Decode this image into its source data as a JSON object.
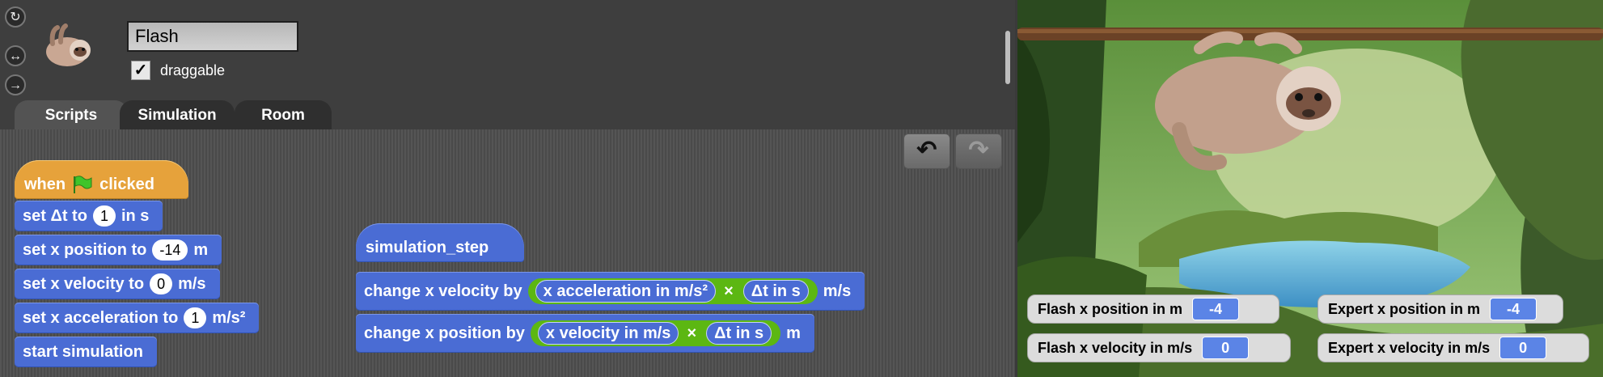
{
  "sprite": {
    "name": "Flash",
    "draggable_label": "draggable",
    "draggable_checked": "✓"
  },
  "rotation_buttons": [
    "↻",
    "↔",
    "→"
  ],
  "tabs": [
    {
      "label": "Scripts",
      "active": true
    },
    {
      "label": "Simulation",
      "active": false
    },
    {
      "label": "Room",
      "active": false
    }
  ],
  "toolbar": {
    "undo_icon": "undo-icon",
    "redo_icon": "redo-icon"
  },
  "script1": {
    "hat_when": "when",
    "hat_clicked": "clicked",
    "set_dt": {
      "label": "set Δt to",
      "value": "1",
      "unit": "in s"
    },
    "set_xpos": {
      "label": "set x position to",
      "value": "-14",
      "unit": "m"
    },
    "set_xvel": {
      "label": "set x velocity to",
      "value": "0",
      "unit": "m/s"
    },
    "set_xacc": {
      "label": "set x acceleration to",
      "value": "1",
      "unit": "m/s²"
    },
    "start": "start simulation"
  },
  "script2": {
    "hat": "simulation_step",
    "vel": {
      "label": "change x velocity by",
      "a": "x acceleration in m/s²",
      "times": "×",
      "b": "Δt in s",
      "unit": "m/s"
    },
    "pos": {
      "label": "change x position by",
      "a": "x velocity in m/s",
      "times": "×",
      "b": "Δt in s",
      "unit": "m"
    }
  },
  "watchers": [
    {
      "label": "Flash x position in m",
      "value": "-4"
    },
    {
      "label": "Expert x position in m",
      "value": "-4"
    },
    {
      "label": "Flash x velocity in m/s",
      "value": "0"
    },
    {
      "label": "Expert x velocity in m/s",
      "value": "0"
    }
  ],
  "colors": {
    "motion": "#4a6cd4",
    "control": "#e6a23b",
    "operators": "#5cb712",
    "flag": "#3fc42a"
  }
}
